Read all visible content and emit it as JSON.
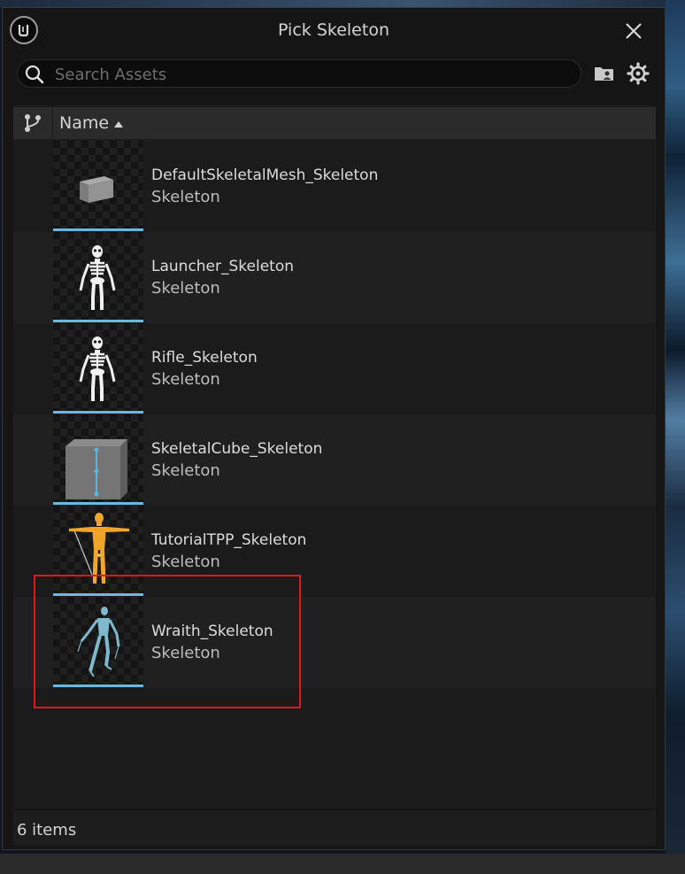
{
  "window": {
    "title": "Pick Skeleton"
  },
  "search": {
    "placeholder": "Search Assets",
    "value": ""
  },
  "list": {
    "column_header": "Name",
    "sort": "ascending",
    "items": [
      {
        "name": "DefaultSkeletalMesh_Skeleton",
        "type": "Skeleton",
        "thumbnail": "gray-box"
      },
      {
        "name": "Launcher_Skeleton",
        "type": "Skeleton",
        "thumbnail": "white-skeleton"
      },
      {
        "name": "Rifle_Skeleton",
        "type": "Skeleton",
        "thumbnail": "white-skeleton"
      },
      {
        "name": "SkeletalCube_Skeleton",
        "type": "Skeleton",
        "thumbnail": "gray-cube"
      },
      {
        "name": "TutorialTPP_Skeleton",
        "type": "Skeleton",
        "thumbnail": "orange-mannequin"
      },
      {
        "name": "Wraith_Skeleton",
        "type": "Skeleton",
        "thumbnail": "blue-wraith"
      }
    ]
  },
  "footer": {
    "item_count": "6 items"
  },
  "colors": {
    "accent_bar": "#6cb8e0",
    "highlight_box": "#e0161a",
    "dialog_bg": "#151515"
  },
  "icons": [
    "unreal-logo-icon",
    "close-icon",
    "search-icon",
    "folder-icon",
    "gear-icon",
    "branch-icon",
    "sort-ascending-icon"
  ]
}
